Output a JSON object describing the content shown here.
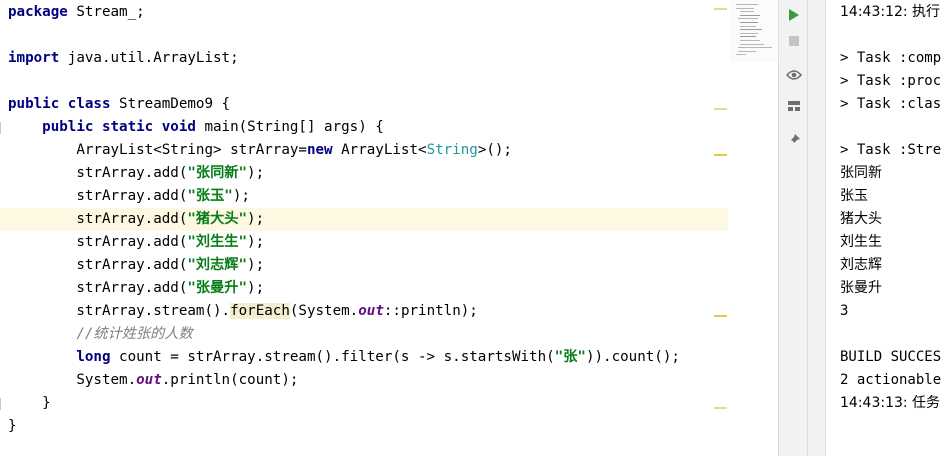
{
  "editor": {
    "lines": [
      {
        "segments": [
          {
            "t": "package ",
            "c": "kw"
          },
          {
            "t": "Stream_;",
            "c": ""
          }
        ]
      },
      {
        "segments": []
      },
      {
        "segments": [
          {
            "t": "import ",
            "c": "kw"
          },
          {
            "t": "java.util.ArrayList;",
            "c": ""
          }
        ]
      },
      {
        "segments": []
      },
      {
        "segments": [
          {
            "t": "public class ",
            "c": "kw"
          },
          {
            "t": "StreamDemo9 {",
            "c": ""
          }
        ]
      },
      {
        "segments": [
          {
            "t": "    public static void ",
            "c": "kw"
          },
          {
            "t": "main(String[] args) {",
            "c": ""
          }
        ]
      },
      {
        "segments": [
          {
            "t": "        ArrayList<String> strArray=",
            "c": ""
          },
          {
            "t": "new ",
            "c": "kw"
          },
          {
            "t": "ArrayList<",
            "c": ""
          },
          {
            "t": "String",
            "c": "gen"
          },
          {
            "t": ">();",
            "c": ""
          }
        ]
      },
      {
        "segments": [
          {
            "t": "        strArray.add(",
            "c": ""
          },
          {
            "t": "\"张同新\"",
            "c": "str"
          },
          {
            "t": ");",
            "c": ""
          }
        ]
      },
      {
        "segments": [
          {
            "t": "        strArray.add(",
            "c": ""
          },
          {
            "t": "\"张玉\"",
            "c": "str"
          },
          {
            "t": ");",
            "c": ""
          }
        ]
      },
      {
        "segments": [
          {
            "t": "        strArray.add(",
            "c": ""
          },
          {
            "t": "\"猪大头\"",
            "c": "str"
          },
          {
            "t": ");",
            "c": ""
          }
        ],
        "highlight": true
      },
      {
        "segments": [
          {
            "t": "        strArray.add(",
            "c": ""
          },
          {
            "t": "\"刘生生\"",
            "c": "str"
          },
          {
            "t": ");",
            "c": ""
          }
        ]
      },
      {
        "segments": [
          {
            "t": "        strArray.add(",
            "c": ""
          },
          {
            "t": "\"刘志辉\"",
            "c": "str"
          },
          {
            "t": ");",
            "c": ""
          }
        ]
      },
      {
        "segments": [
          {
            "t": "        strArray.add(",
            "c": ""
          },
          {
            "t": "\"张曼升\"",
            "c": "str"
          },
          {
            "t": ");",
            "c": ""
          }
        ]
      },
      {
        "segments": [
          {
            "t": "        strArray.stream().",
            "c": ""
          },
          {
            "t": "forEach",
            "c": "hlm"
          },
          {
            "t": "(System.",
            "c": ""
          },
          {
            "t": "out",
            "c": "field"
          },
          {
            "t": "::println);",
            "c": ""
          }
        ]
      },
      {
        "segments": [
          {
            "t": "        //统计姓张的人数",
            "c": "cmt"
          }
        ]
      },
      {
        "segments": [
          {
            "t": "        long ",
            "c": "kw"
          },
          {
            "t": "count = strArray.stream().filter(s -> s.startsWith(",
            "c": ""
          },
          {
            "t": "\"张\"",
            "c": "str"
          },
          {
            "t": ")).count();",
            "c": ""
          }
        ]
      },
      {
        "segments": [
          {
            "t": "        System.",
            "c": ""
          },
          {
            "t": "out",
            "c": "field"
          },
          {
            "t": ".println(count);",
            "c": ""
          }
        ]
      },
      {
        "segments": [
          {
            "t": "    }",
            "c": ""
          }
        ]
      },
      {
        "segments": [
          {
            "t": "}",
            "c": ""
          }
        ]
      }
    ]
  },
  "toolbar": {
    "icons": [
      "run-icon",
      "stop-icon",
      "eye-icon",
      "layout-icon",
      "pin-icon"
    ]
  },
  "console": {
    "lines": [
      "14:43:12: 执行",
      "",
      "> Task :comp",
      "> Task :proc",
      "> Task :clas",
      "",
      "> Task :Stre",
      "张同新",
      "张玉",
      "猪大头",
      "刘生生",
      "刘志辉",
      "张曼升",
      "3",
      "",
      "BUILD SUCCES",
      "2 actionable",
      "14:43:13: 任务"
    ]
  },
  "colors": {
    "keyword": "#000080",
    "string": "#067d17",
    "field": "#660e7a",
    "comment": "#808080",
    "highlight_line": "#fdf8e2"
  }
}
